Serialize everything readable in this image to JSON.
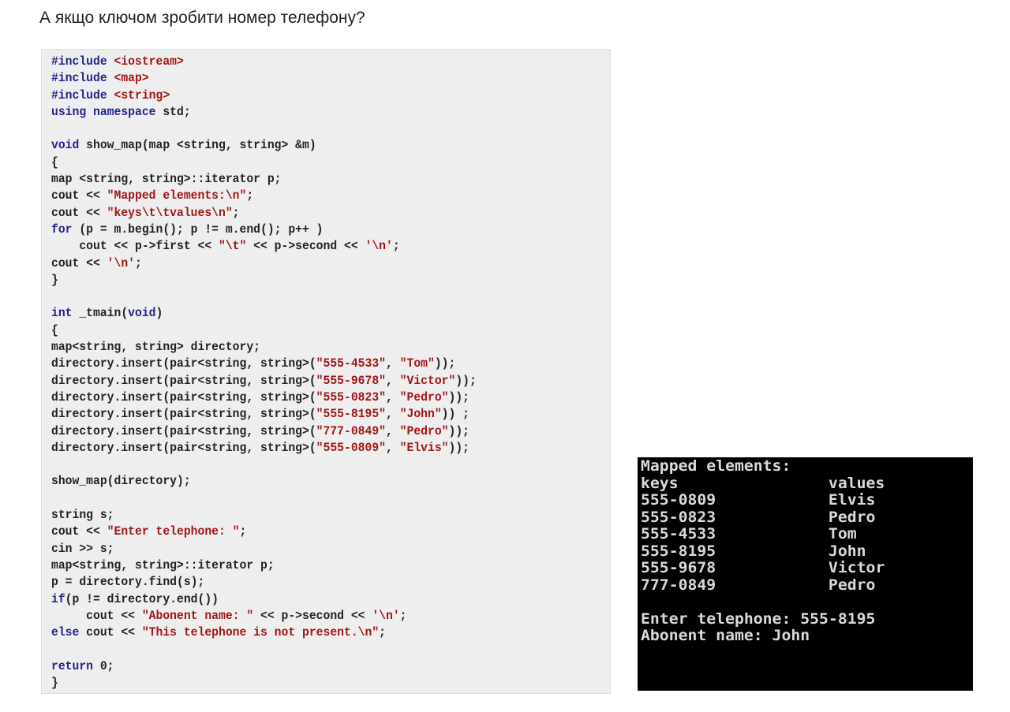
{
  "heading": "А якщо ключом зробити номер телефону?",
  "code_lines": [
    [
      {
        "t": "#include ",
        "c": "kw"
      },
      {
        "t": "<iostream>",
        "c": "str"
      }
    ],
    [
      {
        "t": "#include ",
        "c": "kw"
      },
      {
        "t": "<map>",
        "c": "str"
      }
    ],
    [
      {
        "t": "#include ",
        "c": "kw"
      },
      {
        "t": "<string>",
        "c": "str"
      }
    ],
    [
      {
        "t": "using namespace ",
        "c": "kw"
      },
      {
        "t": "std;",
        "c": ""
      }
    ],
    [],
    [
      {
        "t": "void ",
        "c": "kw"
      },
      {
        "t": "show_map(map <string, string> &m)",
        "c": ""
      }
    ],
    [
      {
        "t": "{",
        "c": ""
      }
    ],
    [
      {
        "t": "map <string, string>::iterator p;",
        "c": ""
      }
    ],
    [
      {
        "t": "cout << ",
        "c": ""
      },
      {
        "t": "\"Mapped elements:\\n\"",
        "c": "str"
      },
      {
        "t": ";",
        "c": ""
      }
    ],
    [
      {
        "t": "cout << ",
        "c": ""
      },
      {
        "t": "\"keys\\t\\tvalues\\n\"",
        "c": "str"
      },
      {
        "t": ";",
        "c": ""
      }
    ],
    [
      {
        "t": "for ",
        "c": "kw"
      },
      {
        "t": "(p = m.begin(); p != m.end(); p++ )",
        "c": ""
      }
    ],
    [
      {
        "t": "    cout << p->first << ",
        "c": ""
      },
      {
        "t": "\"\\t\"",
        "c": "str"
      },
      {
        "t": " << p->second << ",
        "c": ""
      },
      {
        "t": "'\\n'",
        "c": "str"
      },
      {
        "t": ";",
        "c": ""
      }
    ],
    [
      {
        "t": "cout << ",
        "c": ""
      },
      {
        "t": "'\\n'",
        "c": "str"
      },
      {
        "t": ";",
        "c": ""
      }
    ],
    [
      {
        "t": "}",
        "c": ""
      }
    ],
    [],
    [
      {
        "t": "int ",
        "c": "kw"
      },
      {
        "t": "_tmain(",
        "c": ""
      },
      {
        "t": "void",
        "c": "kw"
      },
      {
        "t": ")",
        "c": ""
      }
    ],
    [
      {
        "t": "{",
        "c": ""
      }
    ],
    [
      {
        "t": "map<string, string> directory;",
        "c": ""
      }
    ],
    [
      {
        "t": "directory.insert(pair<string, string>(",
        "c": ""
      },
      {
        "t": "\"555-4533\"",
        "c": "str"
      },
      {
        "t": ", ",
        "c": ""
      },
      {
        "t": "\"Tom\"",
        "c": "str"
      },
      {
        "t": "));",
        "c": ""
      }
    ],
    [
      {
        "t": "directory.insert(pair<string, string>(",
        "c": ""
      },
      {
        "t": "\"555-9678\"",
        "c": "str"
      },
      {
        "t": ", ",
        "c": ""
      },
      {
        "t": "\"Victor\"",
        "c": "str"
      },
      {
        "t": "));",
        "c": ""
      }
    ],
    [
      {
        "t": "directory.insert(pair<string, string>(",
        "c": ""
      },
      {
        "t": "\"555-0823\"",
        "c": "str"
      },
      {
        "t": ", ",
        "c": ""
      },
      {
        "t": "\"Pedro\"",
        "c": "str"
      },
      {
        "t": "));",
        "c": ""
      }
    ],
    [
      {
        "t": "directory.insert(pair<string, string>(",
        "c": ""
      },
      {
        "t": "\"555-8195\"",
        "c": "str"
      },
      {
        "t": ", ",
        "c": ""
      },
      {
        "t": "\"John\"",
        "c": "str"
      },
      {
        "t": ")) ;",
        "c": ""
      }
    ],
    [
      {
        "t": "directory.insert(pair<string, string>(",
        "c": ""
      },
      {
        "t": "\"777-0849\"",
        "c": "str"
      },
      {
        "t": ", ",
        "c": ""
      },
      {
        "t": "\"Pedro\"",
        "c": "str"
      },
      {
        "t": "));",
        "c": ""
      }
    ],
    [
      {
        "t": "directory.insert(pair<string, string>(",
        "c": ""
      },
      {
        "t": "\"555-0809\"",
        "c": "str"
      },
      {
        "t": ", ",
        "c": ""
      },
      {
        "t": "\"Elvis\"",
        "c": "str"
      },
      {
        "t": "));",
        "c": ""
      }
    ],
    [],
    [
      {
        "t": "show_map(directory);",
        "c": ""
      }
    ],
    [],
    [
      {
        "t": "string s;",
        "c": ""
      }
    ],
    [
      {
        "t": "cout << ",
        "c": ""
      },
      {
        "t": "\"Enter telephone: \"",
        "c": "str"
      },
      {
        "t": ";",
        "c": ""
      }
    ],
    [
      {
        "t": "cin >> s;",
        "c": ""
      }
    ],
    [
      {
        "t": "map<string, string>::iterator p;",
        "c": ""
      }
    ],
    [
      {
        "t": "p = directory.find(s);",
        "c": ""
      }
    ],
    [
      {
        "t": "if",
        "c": "kw"
      },
      {
        "t": "(p != directory.end())",
        "c": ""
      }
    ],
    [
      {
        "t": "     cout << ",
        "c": ""
      },
      {
        "t": "\"Abonent name: \"",
        "c": "str"
      },
      {
        "t": " << p->second << ",
        "c": ""
      },
      {
        "t": "'\\n'",
        "c": "str"
      },
      {
        "t": ";",
        "c": ""
      }
    ],
    [
      {
        "t": "else ",
        "c": "kw"
      },
      {
        "t": "cout << ",
        "c": ""
      },
      {
        "t": "\"This telephone is not present.\\n\"",
        "c": "str"
      },
      {
        "t": ";",
        "c": ""
      }
    ],
    [],
    [
      {
        "t": "return ",
        "c": "kw"
      },
      {
        "t": "0;",
        "c": ""
      }
    ],
    [
      {
        "t": "}",
        "c": ""
      }
    ]
  ],
  "console_lines": [
    "Mapped elements:",
    "keys                values",
    "555-0809            Elvis",
    "555-0823            Pedro",
    "555-4533            Tom",
    "555-8195            John",
    "555-9678            Victor",
    "777-0849            Pedro",
    "",
    "Enter telephone: 555-8195",
    "Abonent name: John"
  ],
  "colors": {
    "keyword": "#23238e",
    "string": "#a31515",
    "code_background": "#eeeeee",
    "console_background": "#000000",
    "console_text": "#d9d9d9"
  }
}
